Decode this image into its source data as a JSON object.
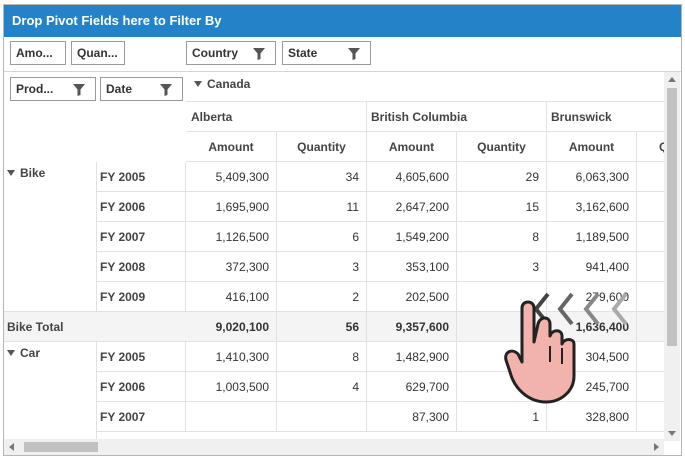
{
  "filter_bar": {
    "title": "Drop Pivot Fields here to Filter By"
  },
  "value_fields": [
    {
      "label": "Amo..."
    },
    {
      "label": "Quan..."
    }
  ],
  "column_fields": [
    {
      "label": "Country"
    },
    {
      "label": "State"
    }
  ],
  "row_fields": [
    {
      "label": "Prod..."
    },
    {
      "label": "Date"
    }
  ],
  "country": {
    "label": "Canada"
  },
  "states": [
    {
      "label": "Alberta"
    },
    {
      "label": "British Columbia"
    },
    {
      "label": "Brunswick"
    }
  ],
  "measures": {
    "amount": "Amount",
    "quantity": "Quantity",
    "partial": "Q"
  },
  "products": {
    "bike": "Bike",
    "bike_total": "Bike Total",
    "car": "Car"
  },
  "rows": [
    {
      "year": "FY 2005",
      "vals": [
        "5,409,300",
        "34",
        "4,605,600",
        "29",
        "6,063,300"
      ]
    },
    {
      "year": "FY 2006",
      "vals": [
        "1,695,900",
        "11",
        "2,647,200",
        "15",
        "3,162,600"
      ]
    },
    {
      "year": "FY 2007",
      "vals": [
        "1,126,500",
        "6",
        "1,549,200",
        "8",
        "1,189,500"
      ]
    },
    {
      "year": "FY 2008",
      "vals": [
        "372,300",
        "3",
        "353,100",
        "3",
        "941,400"
      ]
    },
    {
      "year": "FY 2009",
      "vals": [
        "416,100",
        "2",
        "202,500",
        "",
        "279,600"
      ]
    },
    {
      "year": "",
      "vals": [
        "9,020,100",
        "56",
        "9,357,600",
        "",
        "1,636,400"
      ]
    },
    {
      "year": "FY 2005",
      "vals": [
        "1,410,300",
        "8",
        "1,482,900",
        "",
        "304,500"
      ]
    },
    {
      "year": "FY 2006",
      "vals": [
        "1,003,500",
        "4",
        "629,700",
        "",
        "245,700"
      ]
    },
    {
      "year": "FY 2007",
      "vals": [
        "",
        "",
        "87,300",
        "1",
        "328,800"
      ]
    }
  ],
  "colors": {
    "header_bar": "#2483c8",
    "total_row": "#f4f4f4",
    "hand_fill": "#f3b3ad"
  },
  "icons": {
    "filter": "funnel-icon",
    "expand": "caret-down-icon",
    "gesture": "swipe-left-hand-icon"
  }
}
